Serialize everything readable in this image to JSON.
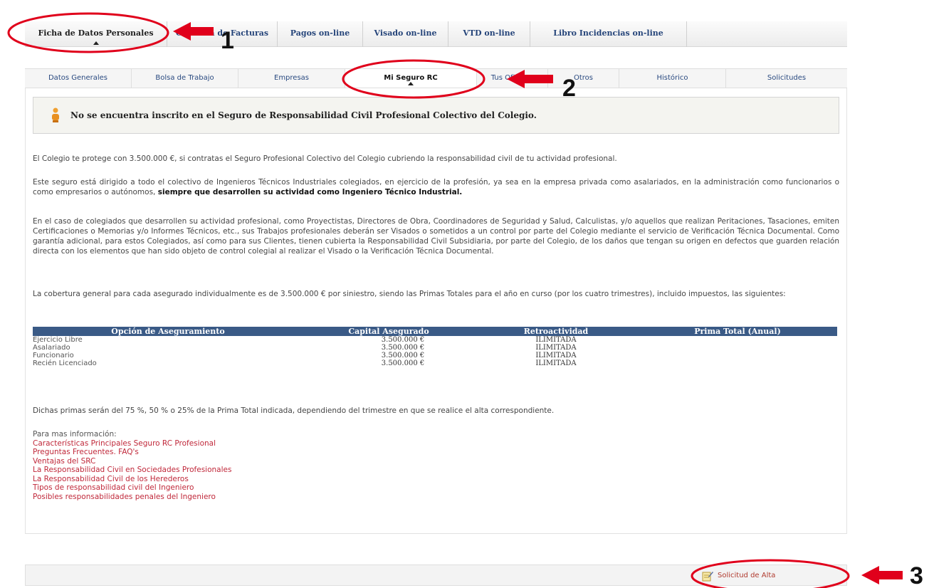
{
  "top_nav": {
    "tabs": [
      {
        "label": "Ficha de Datos Personales",
        "active": true
      },
      {
        "label": "Consulta de Facturas"
      },
      {
        "label": "Pagos on-line"
      },
      {
        "label": "Visado on-line"
      },
      {
        "label": "VTD on-line"
      },
      {
        "label": "Libro Incidencias on-line"
      }
    ]
  },
  "sub_nav": {
    "tabs": [
      {
        "label": "Datos Generales"
      },
      {
        "label": "Bolsa de Trabajo"
      },
      {
        "label": "Empresas"
      },
      {
        "label": "Mi Seguro RC",
        "active": true
      },
      {
        "label": "Tus Oficinas"
      },
      {
        "label": "Otros"
      },
      {
        "label": "Histórico"
      },
      {
        "label": "Solicitudes"
      }
    ]
  },
  "alert": {
    "icon": "warning-person-icon",
    "text": "No se encuentra inscrito en el Seguro de Responsabilidad Civil Profesional Colectivo del Colegio."
  },
  "content": {
    "p1": "El Colegio te protege con 3.500.000 €, si contratas el Seguro Profesional Colectivo del Colegio cubriendo la responsabilidad civil de tu actividad profesional.",
    "p2": "Este seguro está dirigido a todo el colectivo de Ingenieros Técnicos Industriales colegiados, en ejercicio de la profesión, ya sea en la empresa privada como asalariados, en la administración como funcionarios o como empresarios o autónomos,",
    "p2_bold": "siempre que desarrollen su actividad como Ingeniero Técnico Industrial.",
    "p3": "En el caso de colegiados que desarrollen su actividad profesional, como Proyectistas, Directores de Obra, Coordinadores de Seguridad y Salud, Calculistas, y/o aquellos que realizan Peritaciones, Tasaciones, emiten Certificaciones o Memorias y/o Informes Técnicos, etc., sus Trabajos profesionales deberán ser Visados o sometidos a un control por parte del Colegio mediante el servicio de Verificación Técnica Documental. Como garantía adicional, para estos Colegiados, así como para sus Clientes, tienen cubierta la Responsabilidad Civil Subsidiaria, por parte del Colegio, de los daños que tengan su origen en defectos que guarden relación directa con los elementos que han sido objeto de control colegial al realizar el Visado o la Verificación Técnica Documental.",
    "p4": "La cobertura general para cada asegurado individualmente es de 3.500.000 € por siniestro, siendo las Primas Totales para el año en curso (por los cuatro trimestres), incluido impuestos, las siguientes:",
    "p5": "Dichas primas serán del 75 %, 50 % o 25% de la Prima Total indicada, dependiendo del trimestre en que se realice el alta correspondiente."
  },
  "table": {
    "headers": [
      "Opción de Aseguramiento",
      "Capital Asegurado",
      "Retroactividad",
      "Prima Total (Anual)"
    ],
    "rows": [
      [
        "Ejercicio Libre",
        "3.500.000 €",
        "ILIMITADA",
        ""
      ],
      [
        "Asalariado",
        "3.500.000 €",
        "ILIMITADA",
        ""
      ],
      [
        "Funcionario",
        "3.500.000 €",
        "ILIMITADA",
        ""
      ],
      [
        "Recién Licenciado",
        "3.500.000 €",
        "ILIMITADA",
        ""
      ]
    ]
  },
  "links": {
    "heading": "Para mas información:",
    "items": [
      "Características Principales Seguro RC Profesional",
      "Preguntas Frecuentes. FAQ's",
      "Ventajas del SRC",
      "La Responsabilidad Civil en Sociedades Profesionales",
      "La Responsabilidad Civil de los Herederos",
      "Tipos de responsabilidad civil del Ingeniero",
      "Posibles responsabilidades penales del Ingeniero"
    ]
  },
  "bottom": {
    "alta_label": "Solicitud de Alta",
    "alta_icon": "edit-document-icon"
  },
  "annotations": {
    "n1": "1",
    "n2": "2",
    "n3": "3",
    "color": "#e0001b"
  }
}
